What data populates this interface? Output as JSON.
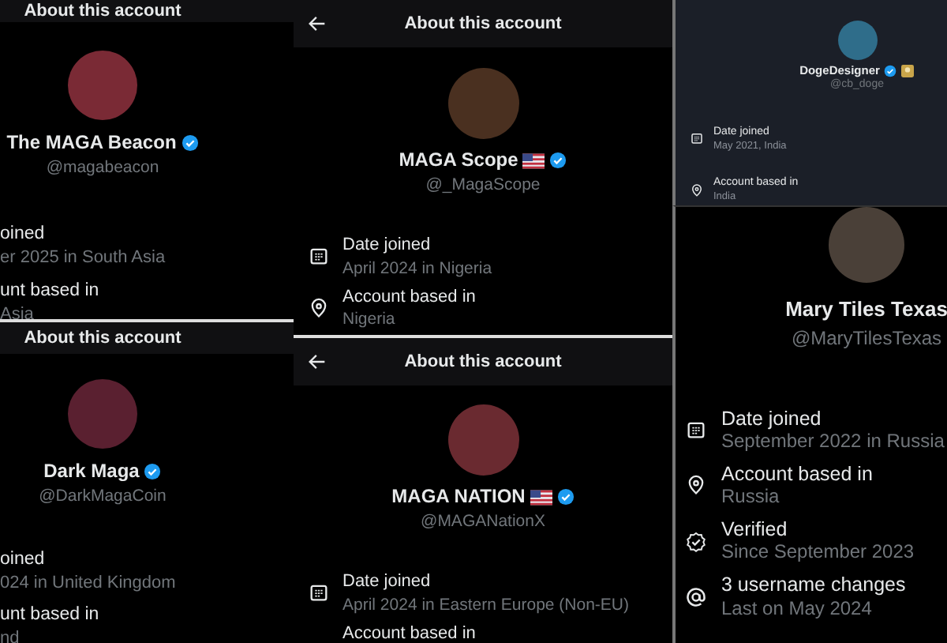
{
  "columns": [
    {
      "panels": [
        {
          "kind": "black",
          "header": {
            "title": "About this account"
          },
          "name": "The MAGA Beacon",
          "verified": true,
          "handle": "@magabeacon",
          "rows": [
            {
              "label": "oined",
              "value": "er 2025 in South Asia"
            },
            {
              "label": "unt based in",
              "value": "Asia"
            }
          ]
        },
        {
          "kind": "black",
          "header": {
            "title": "About this account"
          },
          "name": "Dark Maga",
          "verified": true,
          "handle": "@DarkMagaCoin",
          "rows": [
            {
              "label": "oined",
              "value": "024 in United Kingdom"
            },
            {
              "label": "unt based in",
              "value": "nd"
            }
          ]
        }
      ]
    },
    {
      "panels": [
        {
          "kind": "black",
          "header": {
            "title": "About this account",
            "back_button": true
          },
          "name": "MAGA Scope",
          "verified": true,
          "flag_badge": true,
          "handle": "@_MagaScope",
          "rows": [
            {
              "kind": "date",
              "label": "Date joined",
              "value": "April 2024 in Nigeria"
            },
            {
              "kind": "location",
              "label": "Account based in",
              "value": "Nigeria"
            }
          ]
        },
        {
          "kind": "black",
          "header": {
            "title": "About this account",
            "back_button": true
          },
          "name": "MAGA NATION",
          "verified": true,
          "flag_badge": true,
          "handle": "@MAGANationX",
          "rows": [
            {
              "kind": "date",
              "label": "Date joined",
              "value": "April 2024 in Eastern Europe (Non-EU)"
            },
            {
              "label": "Account based in"
            }
          ]
        }
      ]
    },
    {
      "panels": [
        {
          "kind": "dim",
          "name": "DogeDesigner",
          "verified": true,
          "emoji_badge": true,
          "handle": "@cb_doge",
          "rows": [
            {
              "kind": "date",
              "label": "Date joined",
              "value": "May 2021, India"
            },
            {
              "kind": "location",
              "label": "Account based in",
              "value": "India"
            }
          ]
        },
        {
          "kind": "black",
          "name": "Mary Tiles Texas",
          "handle": "@MaryTilesTexas",
          "rows": [
            {
              "kind": "date",
              "label": "Date joined",
              "value": "September 2022 in Russia"
            },
            {
              "kind": "location",
              "label": "Account based in",
              "value": "Russia"
            },
            {
              "kind": "verified",
              "label": "Verified",
              "value": "Since September 2023"
            },
            {
              "kind": "username",
              "label": "3 username changes",
              "value": "Last on May 2024"
            }
          ]
        }
      ]
    }
  ]
}
